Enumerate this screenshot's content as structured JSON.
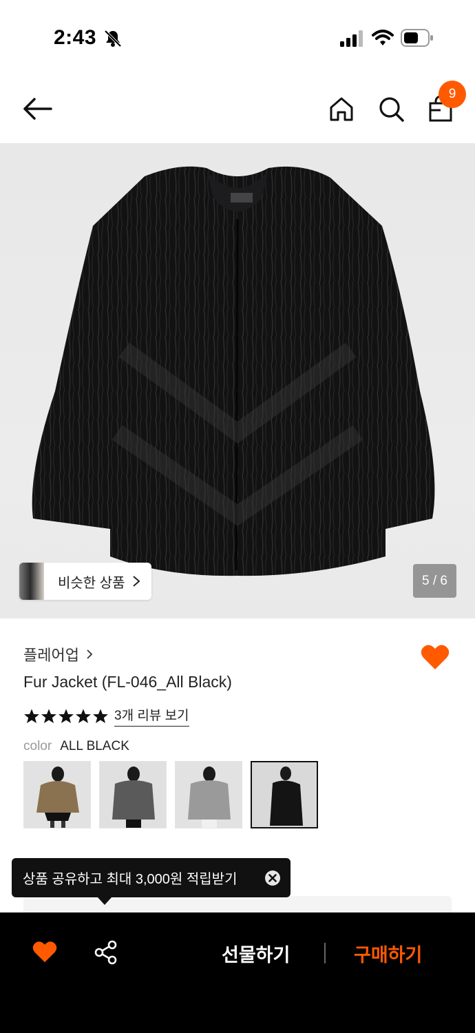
{
  "status_bar": {
    "time": "2:43"
  },
  "header": {
    "cart_count": "9"
  },
  "gallery": {
    "similar_label": "비슷한 상품",
    "page_indicator": "5 / 6"
  },
  "product": {
    "brand": "플레어업",
    "title": "Fur Jacket (FL-046_All Black)",
    "rating_stars": 5,
    "review_link": "3개 리뷰 보기",
    "color_label": "color",
    "color_value": "ALL BLACK",
    "color_options": [
      {
        "icon": "brown-fur-jacket-thumbnail",
        "selected": false
      },
      {
        "icon": "dark-gray-fur-jacket-thumbnail",
        "selected": false
      },
      {
        "icon": "light-gray-fur-jacket-thumbnail",
        "selected": false
      },
      {
        "icon": "black-fur-jacket-thumbnail",
        "selected": true
      }
    ]
  },
  "tooltip": {
    "text": "상품 공유하고 최대 3,000원 적립받기"
  },
  "bottom_bar": {
    "gift_label": "선물하기",
    "buy_label": "구매하기"
  },
  "colors": {
    "accent": "#ff5a00",
    "bottom_bar_bg": "#000000",
    "tooltip_bg": "#111111"
  }
}
